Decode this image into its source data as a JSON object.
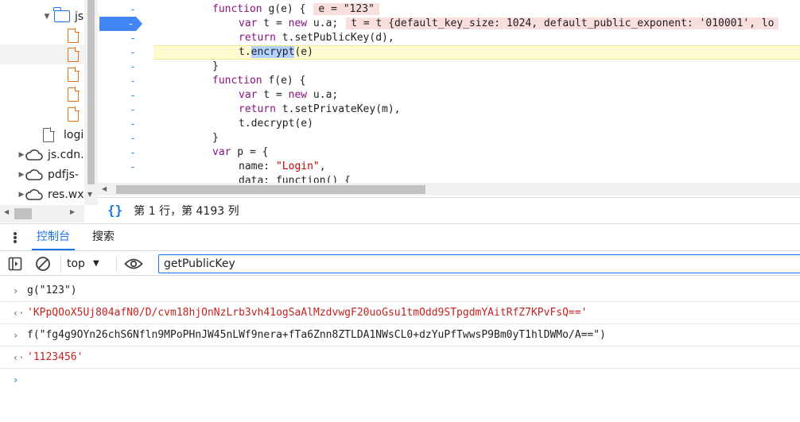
{
  "file_tree": {
    "items": [
      {
        "label": "js",
        "type": "folder",
        "expanded": true
      },
      {
        "label": "",
        "type": "file"
      },
      {
        "label": "",
        "type": "file",
        "selected": true
      },
      {
        "label": "",
        "type": "file"
      },
      {
        "label": "",
        "type": "file"
      },
      {
        "label": "",
        "type": "file"
      },
      {
        "label": "logi",
        "type": "file"
      },
      {
        "label": "js.cdn.",
        "type": "domain"
      },
      {
        "label": "pdfjs-",
        "type": "domain"
      },
      {
        "label": "res.wx",
        "type": "domain"
      }
    ]
  },
  "editor": {
    "gutter_mark": "-",
    "lines": {
      "l0": {
        "kw1": "function",
        "rest": " g(e) {",
        "inline": "e = \"123\""
      },
      "l1": {
        "kw1": "var",
        "mid": " t = ",
        "kw2": "new",
        "rest": " u.a;",
        "inline": "t = t {default_key_size: 1024, default_public_exponent: '010001', lo"
      },
      "l2": {
        "kw1": "return",
        "rest": " t.setPublicKey(d),"
      },
      "l3": {
        "pre": "t.",
        "sel": "encrypt",
        "rest": "(e)"
      },
      "l4": {
        "rest": "}"
      },
      "l5": {
        "kw1": "function",
        "rest": " f(e) {"
      },
      "l6": {
        "kw1": "var",
        "mid": " t = ",
        "kw2": "new",
        "rest": " u.a;"
      },
      "l7": {
        "kw1": "return",
        "rest": " t.setPrivateKey(m),"
      },
      "l8": {
        "rest": "t.decrypt(e)"
      },
      "l9": {
        "rest": "}"
      },
      "l10": {
        "kw1": "var",
        "rest": " p = {"
      },
      "l11": {
        "pre": "name: ",
        "str": "\"Login\"",
        "rest": ","
      },
      "l12": {
        "rest": "data: function() {"
      }
    }
  },
  "status_bar": {
    "braces": "{}",
    "position": "第 1 行，第 4193 列"
  },
  "drawer": {
    "tabs": [
      {
        "label": "控制台",
        "active": true
      },
      {
        "label": "搜索",
        "active": false
      }
    ]
  },
  "console_toolbar": {
    "context": "top",
    "filter_value": "getPublicKey"
  },
  "console": {
    "messages": [
      {
        "kind": "command",
        "marker": "›",
        "text": "g(\"123\")"
      },
      {
        "kind": "result",
        "marker": "‹·",
        "text": "'KPpQOoX5Uj804afN0/D/cvm18hjOnNzLrb3vh41ogSaAlMzdvwgF20uoGsu1tmOdd9STpgdmYAitRfZ7KPvFsQ=='"
      },
      {
        "kind": "command",
        "marker": "›",
        "text": "f(\"fg4g9OYn26chS6Nfln9MPoPHnJW45nLWf9nera+fTa6Znn8ZTLDA1NWsCL0+dzYuPfTwwsP9Bm0yT1hlDWMo/A==\")"
      },
      {
        "kind": "result",
        "marker": "‹·",
        "text": "'1123456'"
      }
    ],
    "prompt_marker": "›"
  },
  "colors": {
    "accent": "#1a73e8",
    "keyword": "#881280",
    "string": "#c80000",
    "exec_line": "#fffbd0",
    "inline_value": "#f9dede",
    "result_text": "#c5221f"
  }
}
